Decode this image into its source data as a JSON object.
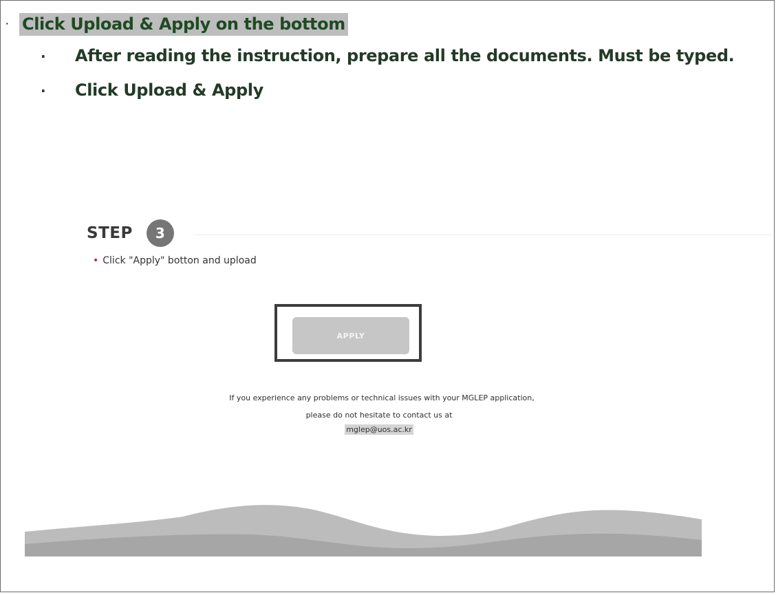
{
  "slide": {
    "bullet_char": "·",
    "heading": "Click Upload & Apply on the bottom",
    "items": [
      {
        "bullet": "·",
        "text": "After reading the instruction, prepare all the documents. Must be typed."
      },
      {
        "bullet": "·",
        "text": "Click Upload & Apply"
      }
    ]
  },
  "screenshot": {
    "step_label": "STEP",
    "step_number": "3",
    "instruction_bullet": "•",
    "instruction": "Click \"Apply\" botton and upload",
    "apply_button": "APPLY",
    "contact_line1": "If you experience any problems or technical issues with your MGLEP application,",
    "contact_line2": "please do not hesitate to contact us at",
    "contact_email": "mglep@uos.ac.kr"
  },
  "colors": {
    "heading_highlight": "#bdbdbd",
    "heading_text": "#1e4a23",
    "step_circle": "#767676",
    "apply_button": "#c6c6c6",
    "highlight_frame": "#3c3c3c",
    "wave": "#a9a9a9"
  }
}
